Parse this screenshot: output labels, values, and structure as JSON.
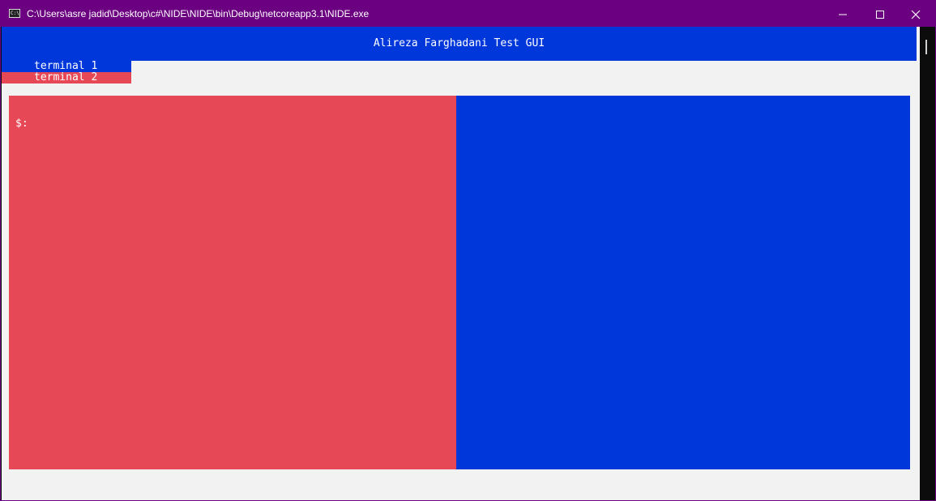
{
  "window": {
    "title": "C:\\Users\\asre jadid\\Desktop\\c#\\NIDE\\NIDE\\bin\\Debug\\netcoreapp3.1\\NIDE.exe",
    "icon": "console-app-icon",
    "app_icon_text": "C:\\",
    "controls": [
      "minimize-icon",
      "maximize-icon",
      "close-icon"
    ]
  },
  "header": {
    "title": "Alireza Farghadani Test GUI"
  },
  "tabs": [
    {
      "label": "terminal 1",
      "color": "#0037da"
    },
    {
      "label": "terminal 2",
      "color": "#e74856",
      "active": true
    }
  ],
  "terminal": {
    "prompt": "$:"
  },
  "colors": {
    "titlebar": "#6b0080",
    "header": "#0037da",
    "left_pane": "#e74856",
    "right_pane": "#0037da",
    "console_bg": "#f2f2f2"
  }
}
